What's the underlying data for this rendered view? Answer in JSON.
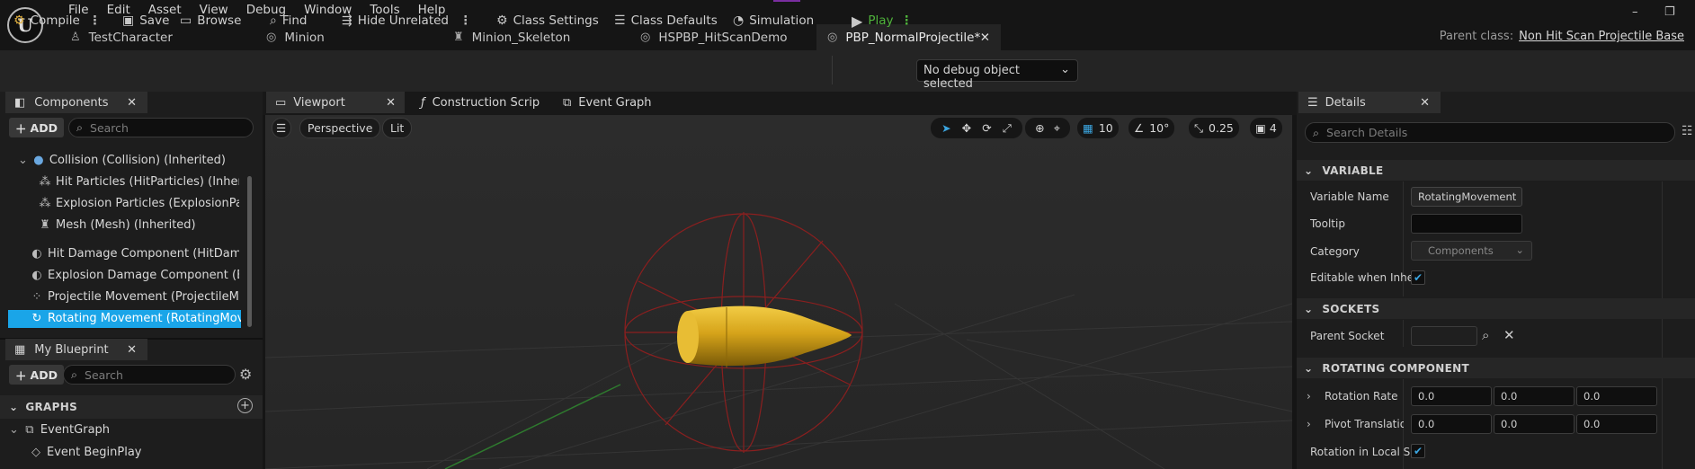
{
  "app": {
    "logo": "U"
  },
  "menu": [
    "File",
    "Edit",
    "Asset",
    "View",
    "Debug",
    "Window",
    "Tools",
    "Help"
  ],
  "doc_tabs": [
    {
      "label": "TestCharacter",
      "icon": "person-icon"
    },
    {
      "label": "Minion",
      "icon": "blueprint-icon"
    },
    {
      "label": "Minion_Skeleton",
      "icon": "skeleton-icon"
    },
    {
      "label": "HSPBP_HitScanDemo",
      "icon": "blueprint-icon"
    },
    {
      "label": "PBP_NormalProjectile*",
      "icon": "blueprint-icon",
      "active": true
    }
  ],
  "parent_class": {
    "label": "Parent class:",
    "value": "Non Hit Scan Projectile Base"
  },
  "toolbar": {
    "compile": "Compile",
    "save": "Save",
    "browse": "Browse",
    "find": "Find",
    "hide_unrelated": "Hide Unrelated",
    "class_settings": "Class Settings",
    "class_defaults": "Class Defaults",
    "simulation": "Simulation",
    "play": "Play",
    "debug_object": "No debug object selected"
  },
  "components": {
    "tab": "Components",
    "add": "ADD",
    "search_placeholder": "Search",
    "items": [
      {
        "label": "Collision (Collision) (Inherited)",
        "icon": "sphere-icon"
      },
      {
        "label": "Hit Particles (HitParticles) (Inherited",
        "icon": "particles-icon"
      },
      {
        "label": "Explosion Particles (ExplosionPartic",
        "icon": "particles-icon"
      },
      {
        "label": "Mesh (Mesh) (Inherited)",
        "icon": "skeleton-icon"
      },
      {
        "label": "Hit Damage Component (HitDamageC",
        "icon": "component-icon"
      },
      {
        "label": "Explosion Damage Component (Explo",
        "icon": "component-icon"
      },
      {
        "label": "Projectile Movement (ProjectileMove",
        "icon": "movement-icon"
      },
      {
        "label": "Rotating Movement (RotatingMoveme",
        "icon": "rotating-icon",
        "selected": true
      }
    ]
  },
  "my_blueprint": {
    "tab": "My Blueprint",
    "add": "ADD",
    "search_placeholder": "Search",
    "graphs_header": "GRAPHS",
    "event_graph": "EventGraph",
    "event_begin_play": "Event BeginPlay"
  },
  "center_tabs": [
    "Viewport",
    "Construction Scrip",
    "Event Graph"
  ],
  "viewport": {
    "perspective": "Perspective",
    "lit": "Lit",
    "grid": "10",
    "angle": "10°",
    "scale": "0.25",
    "camera": "4"
  },
  "details": {
    "tab": "Details",
    "search_placeholder": "Search Details",
    "variable_header": "VARIABLE",
    "sockets_header": "SOCKETS",
    "rotating_header": "ROTATING COMPONENT",
    "variable_name_label": "Variable Name",
    "variable_name_value": "RotatingMovement",
    "tooltip_label": "Tooltip",
    "tooltip_value": "",
    "category_label": "Category",
    "category_value": "Components",
    "editable_label": "Editable when Inher",
    "parent_socket_label": "Parent Socket",
    "rotation_rate_label": "Rotation Rate",
    "rotation_rate": [
      "0.0",
      "0.0",
      "0.0"
    ],
    "pivot_label": "Pivot Translatior",
    "pivot": [
      "0.0",
      "0.0",
      "0.0"
    ],
    "local_space_label": "Rotation in Local Sp"
  },
  "colors": {
    "selection": "#1aa5e8",
    "play": "#4fb33b",
    "bullet": "#d6a41a",
    "bounds": "#8a1f1f"
  }
}
